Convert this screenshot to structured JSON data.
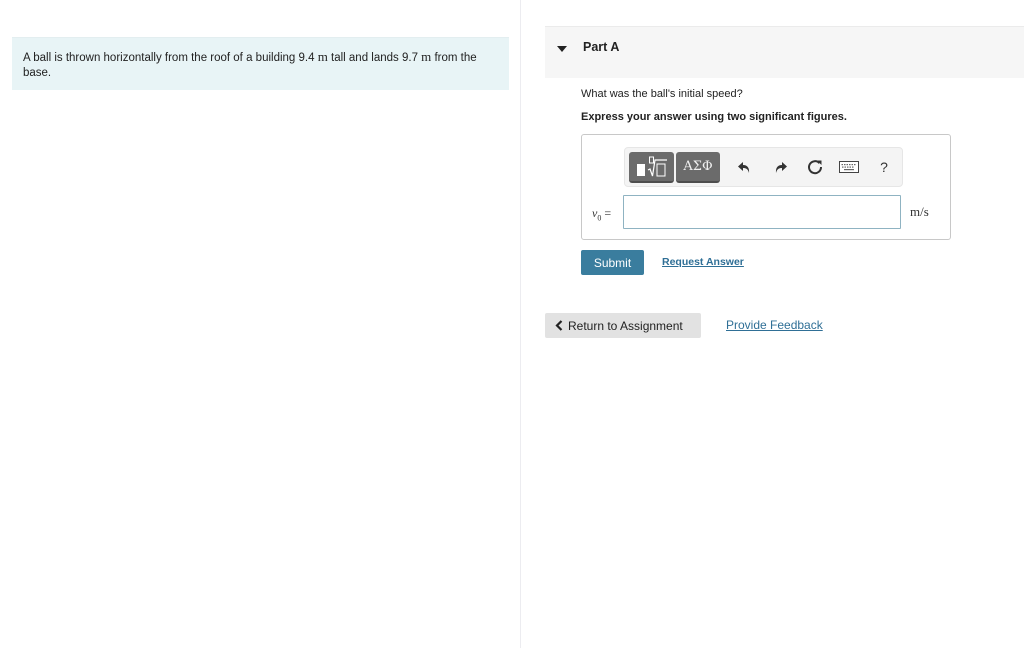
{
  "problem": {
    "text_before": "A ball is thrown horizontally from the roof of a building 9.4 ",
    "unit1": "m",
    "text_middle": " tall and lands 9.7 ",
    "unit2": "m",
    "text_after": " from the base."
  },
  "part": {
    "title": "Part A",
    "expanded": true,
    "question": "What was the ball's initial speed?",
    "instruction": "Express your answer using two significant figures."
  },
  "toolbar": {
    "templates_icon": "templates-sqrt-icon",
    "greek_label": "ΑΣΦ",
    "undo_icon": "undo-icon",
    "redo_icon": "redo-icon",
    "reset_icon": "reset-icon",
    "keyboard_icon": "keyboard-icon",
    "help_label": "?"
  },
  "answer": {
    "variable": "v",
    "subscript": "0",
    "equals": "=",
    "value": "",
    "placeholder": "",
    "unit": "m/s"
  },
  "actions": {
    "submit_label": "Submit",
    "request_answer_label": "Request Answer",
    "return_label": "Return to Assignment",
    "feedback_label": "Provide Feedback"
  },
  "colors": {
    "problem_bg": "#e8f4f6",
    "submit_bg": "#3a7d9e",
    "link": "#2f6f96",
    "toolbar_button": "#6b6b6b",
    "input_border": "#8fb3c2"
  }
}
